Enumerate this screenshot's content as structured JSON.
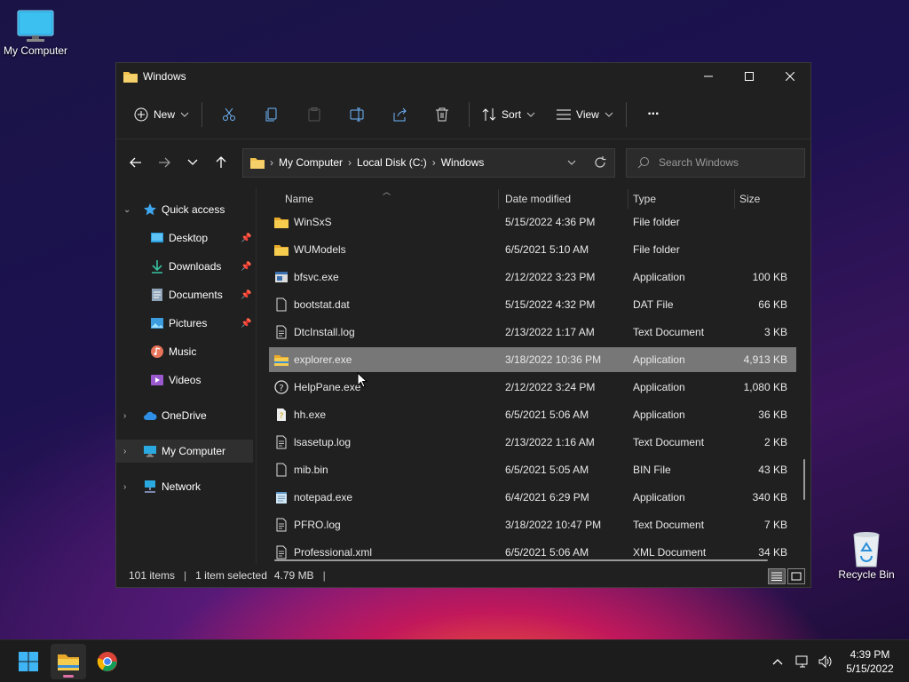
{
  "desktop": {
    "computer_label": "My Computer",
    "recycle_label": "Recycle Bin"
  },
  "window": {
    "title": "Windows",
    "controls": {
      "minimize": "minimize",
      "maximize": "maximize",
      "close": "close"
    }
  },
  "toolbar": {
    "new_label": "New",
    "sort_label": "Sort",
    "view_label": "View",
    "more_label": "···"
  },
  "address": {
    "crumbs": [
      "My Computer",
      "Local Disk (C:)",
      "Windows"
    ],
    "search_placeholder": "Search Windows"
  },
  "nav": {
    "quick_access": "Quick access",
    "desktop": "Desktop",
    "downloads": "Downloads",
    "documents": "Documents",
    "pictures": "Pictures",
    "music": "Music",
    "videos": "Videos",
    "onedrive": "OneDrive",
    "my_computer": "My Computer",
    "network": "Network"
  },
  "columns": {
    "name": "Name",
    "date": "Date modified",
    "type": "Type",
    "size": "Size"
  },
  "files": [
    {
      "name": "WinSxS",
      "date": "5/15/2022 4:36 PM",
      "type": "File folder",
      "size": "",
      "icon": "folder"
    },
    {
      "name": "WUModels",
      "date": "6/5/2021 5:10 AM",
      "type": "File folder",
      "size": "",
      "icon": "folder"
    },
    {
      "name": "bfsvc.exe",
      "date": "2/12/2022 3:23 PM",
      "type": "Application",
      "size": "100 KB",
      "icon": "app"
    },
    {
      "name": "bootstat.dat",
      "date": "5/15/2022 4:32 PM",
      "type": "DAT File",
      "size": "66 KB",
      "icon": "file"
    },
    {
      "name": "DtcInstall.log",
      "date": "2/13/2022 1:17 AM",
      "type": "Text Document",
      "size": "3 KB",
      "icon": "text"
    },
    {
      "name": "explorer.exe",
      "date": "3/18/2022 10:36 PM",
      "type": "Application",
      "size": "4,913 KB",
      "icon": "explorer",
      "selected": true
    },
    {
      "name": "HelpPane.exe",
      "date": "2/12/2022 3:24 PM",
      "type": "Application",
      "size": "1,080 KB",
      "icon": "help"
    },
    {
      "name": "hh.exe",
      "date": "6/5/2021 5:06 AM",
      "type": "Application",
      "size": "36 KB",
      "icon": "hh"
    },
    {
      "name": "lsasetup.log",
      "date": "2/13/2022 1:16 AM",
      "type": "Text Document",
      "size": "2 KB",
      "icon": "text"
    },
    {
      "name": "mib.bin",
      "date": "6/5/2021 5:05 AM",
      "type": "BIN File",
      "size": "43 KB",
      "icon": "file"
    },
    {
      "name": "notepad.exe",
      "date": "6/4/2021 6:29 PM",
      "type": "Application",
      "size": "340 KB",
      "icon": "notepad"
    },
    {
      "name": "PFRO.log",
      "date": "3/18/2022 10:47 PM",
      "type": "Text Document",
      "size": "7 KB",
      "icon": "text"
    },
    {
      "name": "Professional.xml",
      "date": "6/5/2021 5:06 AM",
      "type": "XML Document",
      "size": "34 KB",
      "icon": "text"
    }
  ],
  "status": {
    "count": "101 items",
    "selection": "1 item selected",
    "size": "4.79 MB"
  },
  "clock": {
    "time": "4:39 PM",
    "date": "5/15/2022"
  },
  "colors": {
    "accent": "#0078d4",
    "folder": "#f2c14e",
    "selected_row": "#777777"
  }
}
